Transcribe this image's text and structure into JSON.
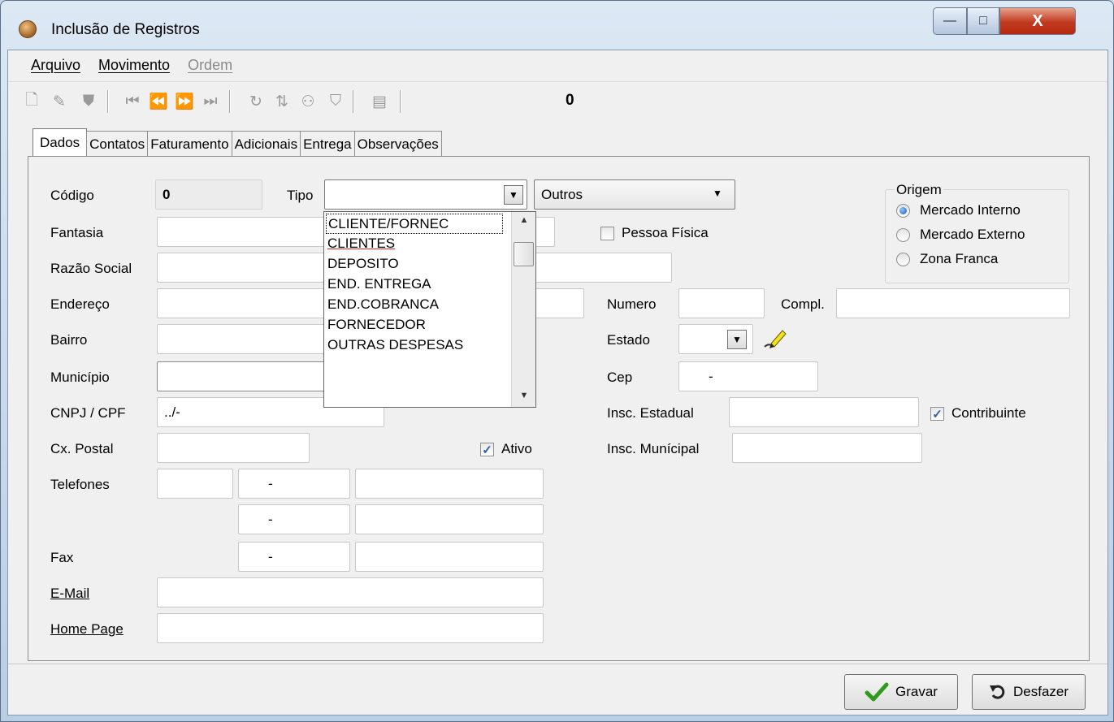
{
  "window": {
    "title": "Inclusão de Registros",
    "minimize": "—",
    "maximize": "□",
    "close": "X"
  },
  "menu": {
    "arquivo": "Arquivo",
    "movimento": "Movimento",
    "ordem": "Ordem"
  },
  "toolbar": {
    "counter": "0"
  },
  "tabs": [
    "Dados",
    "Contatos",
    "Faturamento",
    "Adicionais",
    "Entrega",
    "Observações"
  ],
  "form": {
    "codigo_label": "Código",
    "codigo_value": "0",
    "tipo_label": "Tipo",
    "tipo_value": "",
    "tipo2_value": "Outros",
    "fantasia_label": "Fantasia",
    "razao_label": "Razão Social",
    "endereco_label": "Endereço",
    "numero_label": "Numero",
    "compl_label": "Compl.",
    "bairro_label": "Bairro",
    "estado_label": "Estado",
    "municipio_label": "Município",
    "cep_label": "Cep",
    "cep_value": "-",
    "cnpj_label": "CNPJ / CPF",
    "cnpj_value": "../-",
    "insc_estadual_label": "Insc. Estadual",
    "contribuinte_label": "Contribuinte",
    "cx_postal_label": "Cx. Postal",
    "ativo_label": "Ativo",
    "insc_municipal_label": "Insc. Munícipal",
    "telefones_label": "Telefones",
    "tel1_value": "-",
    "tel2_value": "-",
    "fax_label": "Fax",
    "fax_value": "-",
    "email_label": "E-Mail",
    "homepage_label": "Home Page",
    "pessoa_fisica_label": "Pessoa Física"
  },
  "origem": {
    "legend": "Origem",
    "options": [
      "Mercado Interno",
      "Mercado Externo",
      "Zona Franca"
    ]
  },
  "dropdown": {
    "items": [
      "CLIENTE/FORNEC",
      "CLIENTES",
      "DEPOSITO",
      "END. ENTREGA",
      "END.COBRANCA",
      "FORNECEDOR",
      "OUTRAS DESPESAS"
    ]
  },
  "buttons": {
    "gravar": "Gravar",
    "desfazer": "Desfazer"
  }
}
